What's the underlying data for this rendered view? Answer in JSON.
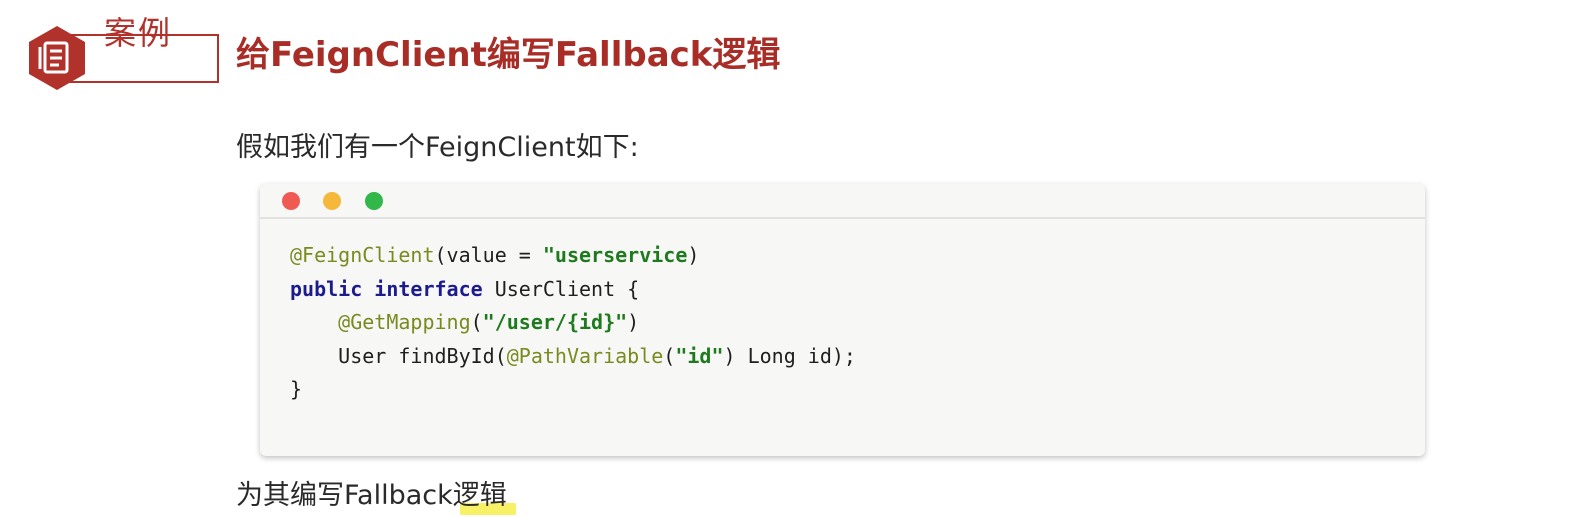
{
  "badge": {
    "label": "案例",
    "icon": "document-icon",
    "color": "#b0322b"
  },
  "title": "给FeignClient编写Fallback逻辑",
  "intro": "假如我们有一个FeignClient如下:",
  "code": {
    "line1": {
      "ann": "@FeignClient",
      "a": "(value = ",
      "str": "\"userservice",
      "b": ")"
    },
    "line2": {
      "kw1": "public",
      "kw2": "interface",
      "rest": " UserClient {"
    },
    "line3": {
      "indent": "    ",
      "ann": "@GetMapping",
      "a": "(",
      "str": "\"/user/{id}\"",
      "b": ")"
    },
    "line4": {
      "a": "    User findById(",
      "ann": "@PathVariable",
      "b": "(",
      "str": "\"id\"",
      "c": ") Long id);"
    },
    "line5": "}"
  },
  "footer": "为其编写Fallback逻辑",
  "colors": {
    "title": "#a92d27",
    "annotation": "#7a8a1f",
    "keyword": "#1c1c8c",
    "string": "#1f7a1f"
  }
}
